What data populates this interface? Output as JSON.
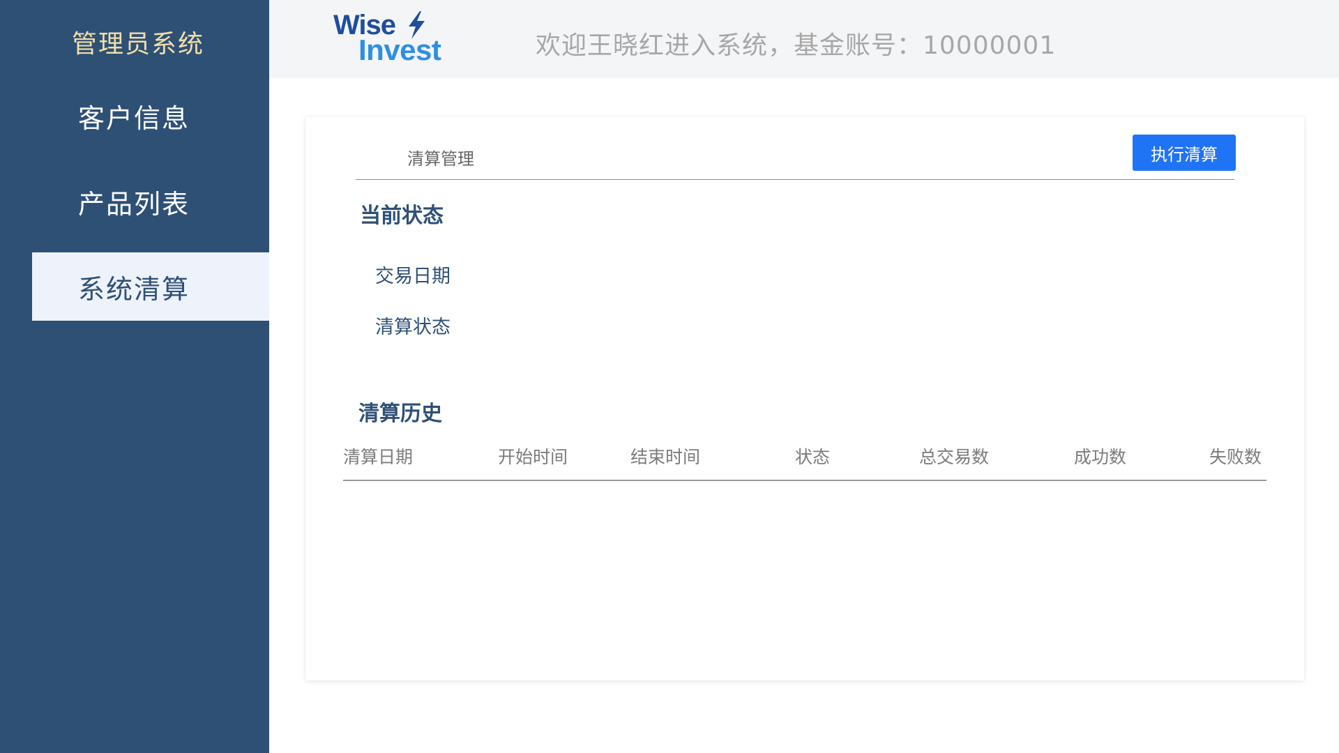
{
  "sidebar": {
    "title": "管理员系统",
    "items": [
      {
        "label": "客户信息"
      },
      {
        "label": "产品列表"
      },
      {
        "label": "系统清算",
        "active": true
      }
    ]
  },
  "header": {
    "logo": {
      "line1": "Wise",
      "line2": "Invest"
    },
    "welcome": "欢迎王晓红进入系统，基金账号：10000001"
  },
  "main": {
    "card_title": "清算管理",
    "execute_button": "执行清算",
    "current_status": {
      "title": "当前状态",
      "trade_date_label": "交易日期",
      "settle_status_label": "清算状态"
    },
    "history": {
      "title": "清算历史",
      "columns": [
        "清算日期",
        "开始时间",
        "结束时间",
        "状态",
        "总交易数",
        "成功数",
        "失败数"
      ],
      "rows": []
    }
  },
  "colors": {
    "sidebar_bg": "#2e5075",
    "sidebar_title": "#f3dfa6",
    "active_item_bg": "#eef2fb",
    "primary_button": "#1f73f5",
    "logo_dark": "#1e4e9c",
    "logo_light": "#2d8fe3"
  }
}
